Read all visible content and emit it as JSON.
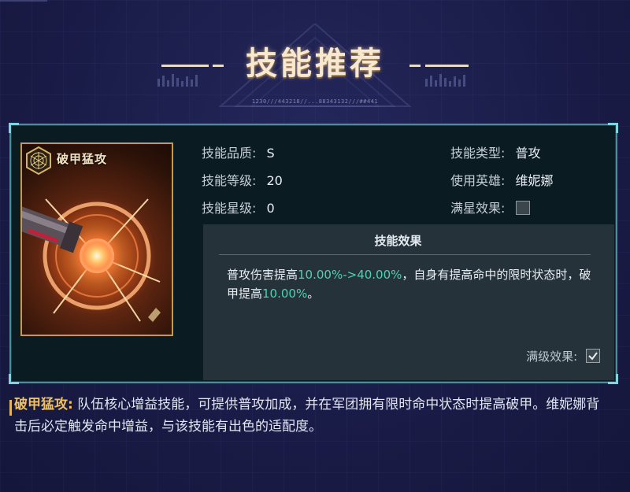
{
  "header": {
    "title": "技能推荐",
    "code_line": "1230///443218//...88343132///##441"
  },
  "skill_card": {
    "name": "破甲猛攻",
    "emblem_icon": "hexagon-web-emblem-icon",
    "art_icon": "energy-cannon-burst-icon"
  },
  "info_left": {
    "quality_label": "技能品质:",
    "quality_value": "S",
    "level_label": "技能等级:",
    "level_value": "20",
    "star_label": "技能星级:",
    "star_value": "0"
  },
  "info_right": {
    "type_label": "技能类型:",
    "type_value": "普攻",
    "hero_label": "使用英雄:",
    "hero_value": "维妮娜",
    "full_star_label": "满星效果:",
    "full_star_checked": false
  },
  "effect": {
    "title": "技能效果",
    "text_part1": "普攻伤害提高",
    "highlight1": "10.00%->40.00%",
    "text_part2": "，自身有提高命中的限时状态时，破甲提高",
    "highlight2": "10.00%",
    "text_part3": "。",
    "full_level_label": "满级效果:",
    "full_level_checked": true
  },
  "description": {
    "name": "破甲猛攻:",
    "text": " 队伍核心增益技能，可提供普攻加成，并在军团拥有限时命中状态时提高破甲。维妮娜背击后必定触发命中增益，与该技能有出色的适配度。"
  },
  "colors": {
    "highlight": "#4fd0b4",
    "panel_border": "#4e8c9c",
    "card_border": "#c89a48",
    "desc_name": "#f0c060"
  }
}
